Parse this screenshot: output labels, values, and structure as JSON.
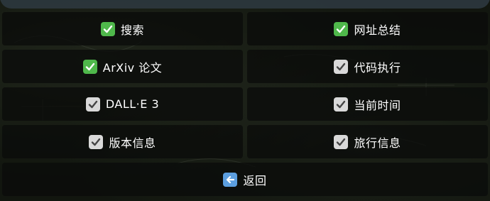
{
  "options": [
    {
      "label": "搜索",
      "checked": true,
      "icon": "check-green-icon"
    },
    {
      "label": "网址总结",
      "checked": true,
      "icon": "check-green-icon"
    },
    {
      "label": "ArXiv 论文",
      "checked": true,
      "icon": "check-green-icon"
    },
    {
      "label": "代码执行",
      "checked": true,
      "icon": "check-gray-icon"
    },
    {
      "label": "DALL·E 3",
      "checked": true,
      "icon": "check-gray-icon"
    },
    {
      "label": "当前时间",
      "checked": true,
      "icon": "check-gray-icon"
    },
    {
      "label": "版本信息",
      "checked": true,
      "icon": "check-gray-icon"
    },
    {
      "label": "旅行信息",
      "checked": true,
      "icon": "check-gray-icon"
    }
  ],
  "back": {
    "label": "返回",
    "icon": "left-arrow-icon"
  },
  "colors": {
    "green_check": "#4fb84b",
    "gray_check": "#d9d9d9",
    "back_icon": "#5c9fe0"
  }
}
